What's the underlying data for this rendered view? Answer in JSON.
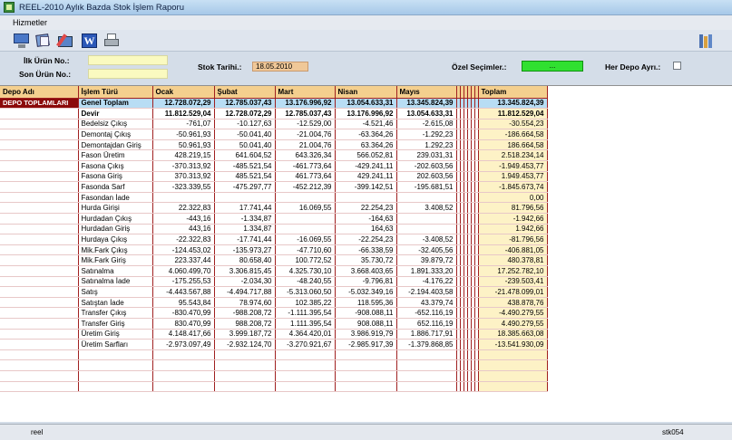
{
  "window": {
    "title": "REEL-2010 Aylık Bazda Stok İşlem Raporu"
  },
  "menu": {
    "items": [
      "Hizmetler"
    ]
  },
  "filters": {
    "ilk_urun_label": "İlk Ürün No.:",
    "son_urun_label": "Son Ürün No.:",
    "stok_tarihi_label": "Stok Tarihi.:",
    "stok_tarihi_value": "18.05.2010",
    "ozel_secimler_label": "Özel Seçimler.:",
    "ozel_secimler_button": "...",
    "her_depo_label": "Her Depo Ayrı.:"
  },
  "table": {
    "headers": {
      "depo": "Depo Adı",
      "islem": "İşlem Türü",
      "ocak": "Ocak",
      "subat": "Şubat",
      "mart": "Mart",
      "nisan": "Nisan",
      "mayis": "Mayıs",
      "toplam": "Toplam"
    },
    "depo_name": "DEPO TOPLAMLARI",
    "rows": [
      {
        "islem": "Genel Toplam",
        "ocak": "12.728.072,29",
        "subat": "12.785.037,43",
        "mart": "13.176.996,92",
        "nisan": "13.054.633,31",
        "mayis": "13.345.824,39",
        "toplam": "13.345.824,39"
      },
      {
        "islem": "Devir",
        "ocak": "11.812.529,04",
        "subat": "12.728.072,29",
        "mart": "12.785.037,43",
        "nisan": "13.176.996,92",
        "mayis": "13.054.633,31",
        "toplam": "11.812.529,04"
      },
      {
        "islem": "Bedelsiz Çıkış",
        "ocak": "-761,07",
        "subat": "-10.127,63",
        "mart": "-12.529,00",
        "nisan": "-4.521,46",
        "mayis": "-2.615,08",
        "toplam": "-30.554,23"
      },
      {
        "islem": "Demontaj Çıkış",
        "ocak": "-50.961,93",
        "subat": "-50.041,40",
        "mart": "-21.004,76",
        "nisan": "-63.364,26",
        "mayis": "-1.292,23",
        "toplam": "-186.664,58"
      },
      {
        "islem": "Demontajdan Giriş",
        "ocak": "50.961,93",
        "subat": "50.041,40",
        "mart": "21.004,76",
        "nisan": "63.364,26",
        "mayis": "1.292,23",
        "toplam": "186.664,58"
      },
      {
        "islem": "Fason Üretim",
        "ocak": "428.219,15",
        "subat": "641.604,52",
        "mart": "643.326,34",
        "nisan": "566.052,81",
        "mayis": "239.031,31",
        "toplam": "2.518.234,14"
      },
      {
        "islem": "Fasona Çıkış",
        "ocak": "-370.313,92",
        "subat": "-485.521,54",
        "mart": "-461.773,64",
        "nisan": "-429.241,11",
        "mayis": "-202.603,56",
        "toplam": "-1.949.453,77"
      },
      {
        "islem": "Fasona Giriş",
        "ocak": "370.313,92",
        "subat": "485.521,54",
        "mart": "461.773,64",
        "nisan": "429.241,11",
        "mayis": "202.603,56",
        "toplam": "1.949.453,77"
      },
      {
        "islem": "Fasonda Sarf",
        "ocak": "-323.339,55",
        "subat": "-475.297,77",
        "mart": "-452.212,39",
        "nisan": "-399.142,51",
        "mayis": "-195.681,51",
        "toplam": "-1.845.673,74"
      },
      {
        "islem": "Fasondan İade",
        "ocak": "",
        "subat": "",
        "mart": "",
        "nisan": "",
        "mayis": "",
        "toplam": "0,00"
      },
      {
        "islem": "Hurda Girişi",
        "ocak": "22.322,83",
        "subat": "17.741,44",
        "mart": "16.069,55",
        "nisan": "22.254,23",
        "mayis": "3.408,52",
        "toplam": "81.796,56"
      },
      {
        "islem": "Hurdadan Çıkış",
        "ocak": "-443,16",
        "subat": "-1.334,87",
        "mart": "",
        "nisan": "-164,63",
        "mayis": "",
        "toplam": "-1.942,66"
      },
      {
        "islem": "Hurdadan Giriş",
        "ocak": "443,16",
        "subat": "1.334,87",
        "mart": "",
        "nisan": "164,63",
        "mayis": "",
        "toplam": "1.942,66"
      },
      {
        "islem": "Hurdaya Çıkış",
        "ocak": "-22.322,83",
        "subat": "-17.741,44",
        "mart": "-16.069,55",
        "nisan": "-22.254,23",
        "mayis": "-3.408,52",
        "toplam": "-81.796,56"
      },
      {
        "islem": "Mik.Fark Çıkış",
        "ocak": "-124.453,02",
        "subat": "-135.973,27",
        "mart": "-47.710,60",
        "nisan": "-66.338,59",
        "mayis": "-32.405,56",
        "toplam": "-406.881,05"
      },
      {
        "islem": "Mik.Fark Giriş",
        "ocak": "223.337,44",
        "subat": "80.658,40",
        "mart": "100.772,52",
        "nisan": "35.730,72",
        "mayis": "39.879,72",
        "toplam": "480.378,81"
      },
      {
        "islem": "Satınalma",
        "ocak": "4.060.499,70",
        "subat": "3.306.815,45",
        "mart": "4.325.730,10",
        "nisan": "3.668.403,65",
        "mayis": "1.891.333,20",
        "toplam": "17.252.782,10"
      },
      {
        "islem": "Satınalma İade",
        "ocak": "-175.255,53",
        "subat": "-2.034,30",
        "mart": "-48.240,55",
        "nisan": "-9.796,81",
        "mayis": "-4.176,22",
        "toplam": "-239.503,41"
      },
      {
        "islem": "Satış",
        "ocak": "-4.443.567,88",
        "subat": "-4.494.717,88",
        "mart": "-5.313.060,50",
        "nisan": "-5.032.349,16",
        "mayis": "-2.194.403,58",
        "toplam": "-21.478.099,01"
      },
      {
        "islem": "Satıştan İade",
        "ocak": "95.543,84",
        "subat": "78.974,60",
        "mart": "102.385,22",
        "nisan": "118.595,36",
        "mayis": "43.379,74",
        "toplam": "438.878,76"
      },
      {
        "islem": "Transfer Çıkış",
        "ocak": "-830.470,99",
        "subat": "-988.208,72",
        "mart": "-1.111.395,54",
        "nisan": "-908.088,11",
        "mayis": "-652.116,19",
        "toplam": "-4.490.279,55"
      },
      {
        "islem": "Transfer Giriş",
        "ocak": "830.470,99",
        "subat": "988.208,72",
        "mart": "1.111.395,54",
        "nisan": "908.088,11",
        "mayis": "652.116,19",
        "toplam": "4.490.279,55"
      },
      {
        "islem": "Üretim Giriş",
        "ocak": "4.148.417,66",
        "subat": "3.999.187,72",
        "mart": "4.364.420,01",
        "nisan": "3.986.919,79",
        "mayis": "1.886.717,91",
        "toplam": "18.385.663,08"
      },
      {
        "islem": "Üretim Sarfları",
        "ocak": "-2.973.097,49",
        "subat": "-2.932.124,70",
        "mart": "-3.270.921,67",
        "nisan": "-2.985.917,39",
        "mayis": "-1.379.868,85",
        "toplam": "-13.541.930,09"
      }
    ]
  },
  "status": {
    "left": "reel",
    "right": "stk054"
  }
}
